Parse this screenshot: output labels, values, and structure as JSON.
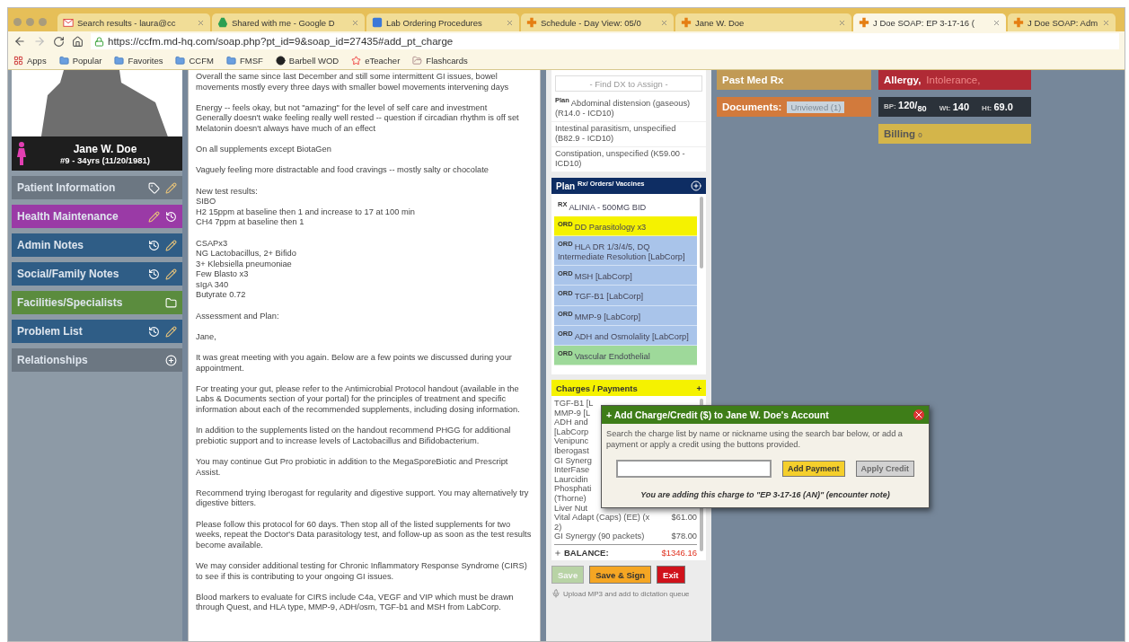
{
  "browser": {
    "tabs": [
      {
        "title": "Search results - laura@cc",
        "selected": false
      },
      {
        "title": "Shared with me - Google D",
        "selected": false
      },
      {
        "title": "Lab Ordering Procedures",
        "selected": false
      },
      {
        "title": "Schedule - Day View: 05/0",
        "selected": false
      },
      {
        "title": "Jane W. Doe",
        "selected": false
      },
      {
        "title": "J Doe SOAP: EP 3-17-16 (",
        "selected": true
      },
      {
        "title": "J Doe SOAP: Adm",
        "selected": false
      }
    ],
    "url": "https://ccfm.md-hq.com/soap.php?pt_id=9&soap_id=27435#add_pt_charge",
    "bookmarks": [
      "Apps",
      "Popular",
      "Favorites",
      "CCFM",
      "FMSF",
      "Barbell WOD",
      "eTeacher",
      "Flashcards"
    ]
  },
  "patient": {
    "name": "Jane W. Doe",
    "details": "#9 - 34yrs (11/20/1981)"
  },
  "sidebar": [
    {
      "label": "Patient Information",
      "color": "#6c7782"
    },
    {
      "label": "Health Maintenance",
      "color": "#9a3aa6"
    },
    {
      "label": "Admin Notes",
      "color": "#2f5d86"
    },
    {
      "label": "Social/Family Notes",
      "color": "#2f5d86"
    },
    {
      "label": "Facilities/Specialists",
      "color": "#5b8c3e"
    },
    {
      "label": "Problem List",
      "color": "#2f5d86"
    },
    {
      "label": "Relationships",
      "color": "#6c7782"
    }
  ],
  "note": [
    [
      "Overall the same since last December and still some intermittent GI issues, bowel movements mostly every three days with smaller bowel movements intervening days"
    ],
    [
      "Energy -- feels okay, but not \"amazing\" for the level of self care and investment",
      "Generally doesn't wake feeling really well rested -- question if circadian rhythm is off set",
      "Melatonin doesn't always have much of an effect"
    ],
    [
      "On all supplements except BiotaGen"
    ],
    [
      "Vaguely feeling more distractable and food cravings -- mostly salty or chocolate"
    ],
    [
      "New test results:",
      "SIBO",
      "H2 15ppm at baseline then 1 and increase to 17 at 100 min",
      "CH4 7ppm at baseline then 1"
    ],
    [
      "CSAPx3",
      "NG Lactobacillus, 2+ Bifido",
      "3+ Klebsiella pneumoniae",
      "Few Blasto x3",
      "sIgA 340",
      "Butyrate 0.72"
    ],
    [
      "Assessment and Plan:"
    ],
    [
      "Jane,"
    ],
    [
      "It was great meeting with you again. Below are a few points we discussed during your appointment."
    ],
    [
      "For treating your gut, please refer to the Antimicrobial Protocol handout (available in the Labs & Documents section of your portal) for the principles of treatment and specific information about each of the recommended supplements, including dosing information."
    ],
    [
      "In addition to the supplements listed on the handout recommend PHGG for additional prebiotic support and to increase levels of Lactobacillus and Bifidobacterium."
    ],
    [
      "You may continue Gut Pro probiotic in addition to the MegaSporeBiotic and Prescript Assist."
    ],
    [
      "Recommend trying Iberogast for regularity and digestive support. You may alternatively try digestive bitters."
    ],
    [
      "Please follow this protocol for 60 days. Then stop all of the listed supplements for two weeks, repeat the Doctor's Data parasitology test, and follow-up as soon as the test results become available."
    ],
    [
      "We may consider additional testing for Chronic Inflammatory Response Syndrome (CIRS) to see if this is contributing to your ongoing GI issues."
    ],
    [
      "Blood markers to evaluate for CIRS include C4a, VEGF and VIP which must be drawn through Quest, and HLA type, MMP-9, ADH/osm, TGF-b1 and MSH from LabCorp."
    ]
  ],
  "diagnosis": {
    "placeholder": "- Find DX to Assign -",
    "items": [
      {
        "tag": "Plan",
        "text": "Abdominal distension (gaseous) (R14.0 - ICD10)"
      },
      {
        "text": "Intestinal parasitism, unspecified (B82.9 - ICD10)"
      },
      {
        "text": "Constipation, unspecified (K59.00 - ICD10)"
      }
    ]
  },
  "plan": {
    "title": "Plan",
    "subtitle": "Rx/ Orders/ Vaccines",
    "items": [
      {
        "tag": "RX",
        "text": "ALINIA - 500MG BID"
      },
      {
        "tag": "ORD",
        "text": "DD Parasitology x3",
        "color": "#f5f200"
      },
      {
        "tag": "ORD",
        "text": "HLA DR 1/3/4/5, DQ Intermediate Resolution [LabCorp]",
        "color": "#a9c4ea"
      },
      {
        "tag": "ORD",
        "text": "MSH [LabCorp]",
        "color": "#a9c4ea"
      },
      {
        "tag": "ORD",
        "text": "TGF-B1 [LabCorp]",
        "color": "#a9c4ea"
      },
      {
        "tag": "ORD",
        "text": "MMP-9 [LabCorp]",
        "color": "#a9c4ea"
      },
      {
        "tag": "ORD",
        "text": "ADH and Osmolality [LabCorp]",
        "color": "#a9c4ea"
      },
      {
        "tag": "ORD",
        "text": "Vascular Endothelial",
        "color": "#9ed99a"
      }
    ]
  },
  "charges": {
    "title": "Charges / Payments",
    "add": "+",
    "items": [
      {
        "name": "TGF-B1 [L"
      },
      {
        "name": "MMP-9 [L"
      },
      {
        "name": "ADH and"
      },
      {
        "name": "[LabCorp"
      },
      {
        "name": "Venipunc"
      },
      {
        "name": "Iberogast"
      },
      {
        "name": "GI Synerg"
      },
      {
        "name": "InterFase"
      },
      {
        "name": "Laurcidin"
      },
      {
        "name": "Phosphati"
      },
      {
        "name": "(Thorne)"
      },
      {
        "name": "Liver Nut"
      },
      {
        "name": "Vital Adapt (Caps) (EE) (x 2)",
        "price": "$61.00"
      },
      {
        "name": "GI Synergy (90 packets)",
        "price": "$78.00"
      }
    ],
    "balance_label": "BALANCE:",
    "balance": "$1346.16"
  },
  "actions": [
    {
      "label": "Save",
      "disabled": true
    },
    {
      "label": "Save & Sign",
      "disabled": false
    },
    {
      "label": "Exit",
      "disabled": false
    }
  ],
  "upload": "Upload MP3 and add to dictation queue",
  "summary": {
    "past_med": "Past Med Rx",
    "allergy": "Allergy,",
    "intolerance": "Intolerance,",
    "documents": "Documents:",
    "unviewed": "Unviewed (1)",
    "vitals": [
      {
        "label": "BP:",
        "value": "120/$_{80}$"
      },
      {
        "label": "Wt:",
        "value": "140"
      },
      {
        "label": "Ht:",
        "value": "69.0"
      }
    ],
    "billing": "Billing",
    "billing_count": "0"
  },
  "modal": {
    "title": "+ Add Charge/Credit ($) to Jane W. Doe's Account",
    "text": "Search the charge list by name or nickname using the search bar below, or add a payment or apply a credit using the buttons provided.",
    "buttons": [
      {
        "label": "Add Payment",
        "disabled": false
      },
      {
        "label": "Apply Credit",
        "disabled": true
      }
    ],
    "footer": "You are adding this charge to \"EP 3-17-16 (AN)\" (encounter note)"
  }
}
